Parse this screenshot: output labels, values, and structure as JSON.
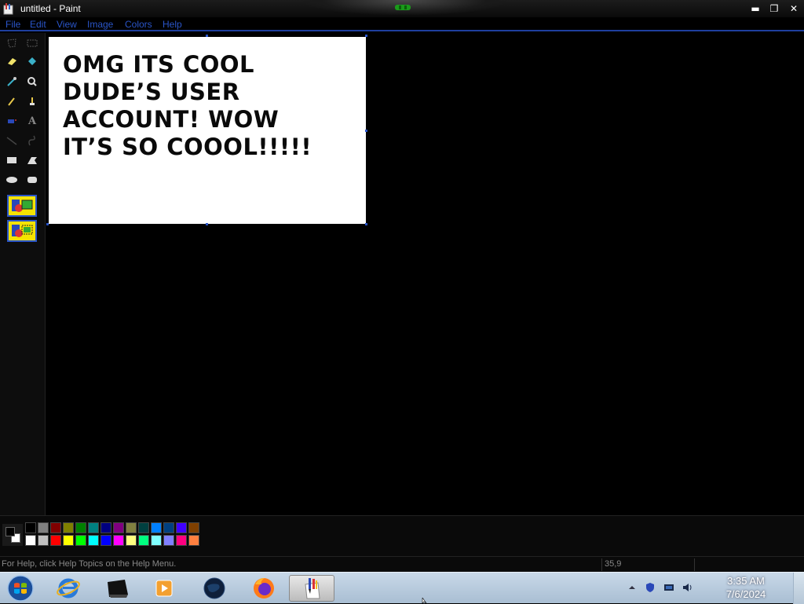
{
  "window": {
    "title": "untitled - Paint",
    "buttons": {
      "minimize": "▬",
      "maximize": "❐",
      "close": "✕"
    }
  },
  "menu": {
    "items": [
      "File",
      "Edit",
      "View",
      "Image",
      "Colors",
      "Help"
    ]
  },
  "canvas": {
    "lines": [
      "OMG ITS COOL",
      "DUDE’S USER",
      "ACCOUNT! WOW",
      "IT’S SO COOOL!!!!!"
    ]
  },
  "tools": [
    "free-select",
    "rect-select",
    "eraser",
    "fill",
    "color-picker",
    "magnifier",
    "pencil",
    "brush",
    "airbrush",
    "text",
    "line",
    "curve",
    "rectangle",
    "polygon",
    "ellipse",
    "rounded-rectangle"
  ],
  "palette": {
    "foreground": "#000000",
    "background": "#ffffff",
    "top_row": [
      "#000000",
      "#808080",
      "#800000",
      "#808000",
      "#008000",
      "#008080",
      "#000080",
      "#800080",
      "#808040",
      "#004040",
      "#0080ff",
      "#004080",
      "#4000ff",
      "#804000"
    ],
    "bottom_row": [
      "#ffffff",
      "#c0c0c0",
      "#ff0000",
      "#ffff00",
      "#00ff00",
      "#00ffff",
      "#0000ff",
      "#ff00ff",
      "#ffff80",
      "#00ff80",
      "#80ffff",
      "#8080ff",
      "#ff0080",
      "#ff8040"
    ]
  },
  "status": {
    "help_text": "For Help, click Help Topics on the Help Menu.",
    "coords": "35,9"
  },
  "taskbar": {
    "apps": [
      "internet-explorer",
      "command-prompt",
      "media-player",
      "globe",
      "firefox",
      "paint"
    ],
    "active_app": "paint",
    "clock_time": "3:35 AM",
    "clock_date": "7/6/2024"
  }
}
